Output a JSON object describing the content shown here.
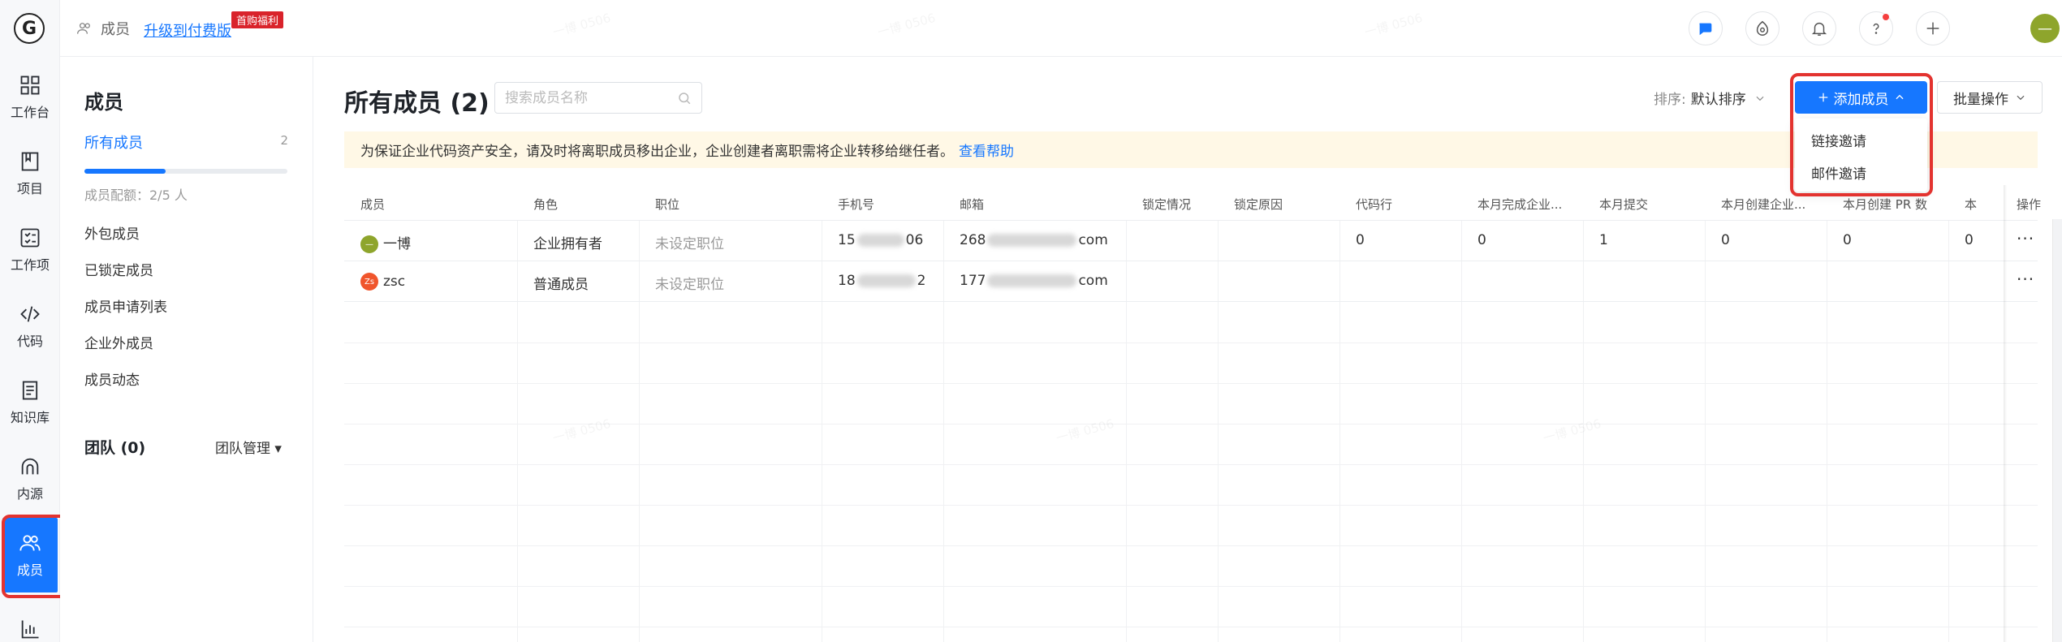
{
  "rail": {
    "logo": "G",
    "items": [
      {
        "label": "工作台",
        "icon": "dashboard-icon"
      },
      {
        "label": "项目",
        "icon": "project-icon"
      },
      {
        "label": "工作项",
        "icon": "workitem-icon"
      },
      {
        "label": "代码",
        "icon": "code-icon"
      },
      {
        "label": "知识库",
        "icon": "book-icon"
      },
      {
        "label": "内源",
        "icon": "innersource-icon"
      },
      {
        "label": "成员",
        "icon": "members-icon",
        "active": true
      },
      {
        "label": "",
        "icon": "stats-icon"
      }
    ]
  },
  "topbar": {
    "crumb": "成员",
    "upgrade": "升级到付费版",
    "promo": "首购福利"
  },
  "sidebar": {
    "title": "成员",
    "all_members": "所有成员",
    "all_count": "2",
    "quota_fraction": 0.4,
    "quota_text": "成员配额：2/5 人",
    "links": [
      "外包成员",
      "已锁定成员",
      "成员申请列表",
      "企业外成员",
      "成员动态"
    ],
    "team_title": "团队 (0)",
    "team_manage": "团队管理 ▾"
  },
  "main": {
    "title": "所有成员 (2)",
    "search_placeholder": "搜索成员名称",
    "sort_label": "排序:",
    "sort_value": "默认排序",
    "add_button": "添加成员",
    "batch_button": "批量操作",
    "notice": "为保证企业代码资产安全，请及时将离职成员移出企业，企业创建者离职需将企业转移给继任者。",
    "notice_link": "查看帮助",
    "dropdown": [
      "链接邀请",
      "邮件邀请"
    ]
  },
  "table": {
    "headers": [
      "成员",
      "角色",
      "职位",
      "手机号",
      "邮箱",
      "锁定情况",
      "锁定原因",
      "代码行",
      "本月完成企业...",
      "本月提交",
      "本月创建企业...",
      "本月创建 PR 数",
      "本",
      "操作"
    ],
    "rows": [
      {
        "avatar_text": "—",
        "avatar_color": "#8ea52c",
        "name": "一博",
        "role": "企业拥有者",
        "position": "未设定职位",
        "phone_start": "15",
        "phone_end": "06",
        "email_start": "268",
        "email_end": "com",
        "code_lines": "0",
        "completed": "0",
        "commits": "1",
        "created": "0",
        "pr": "0",
        "extra": "0",
        "action": "···"
      },
      {
        "avatar_text": "Zs",
        "avatar_color": "#f0552c",
        "name": "zsc",
        "role": "普通成员",
        "position": "未设定职位",
        "phone_start": "18",
        "phone_end": "2",
        "email_start": "177",
        "email_end": "com",
        "code_lines": "",
        "completed": "",
        "commits": "",
        "created": "",
        "pr": "",
        "extra": "",
        "action": "···"
      }
    ]
  }
}
